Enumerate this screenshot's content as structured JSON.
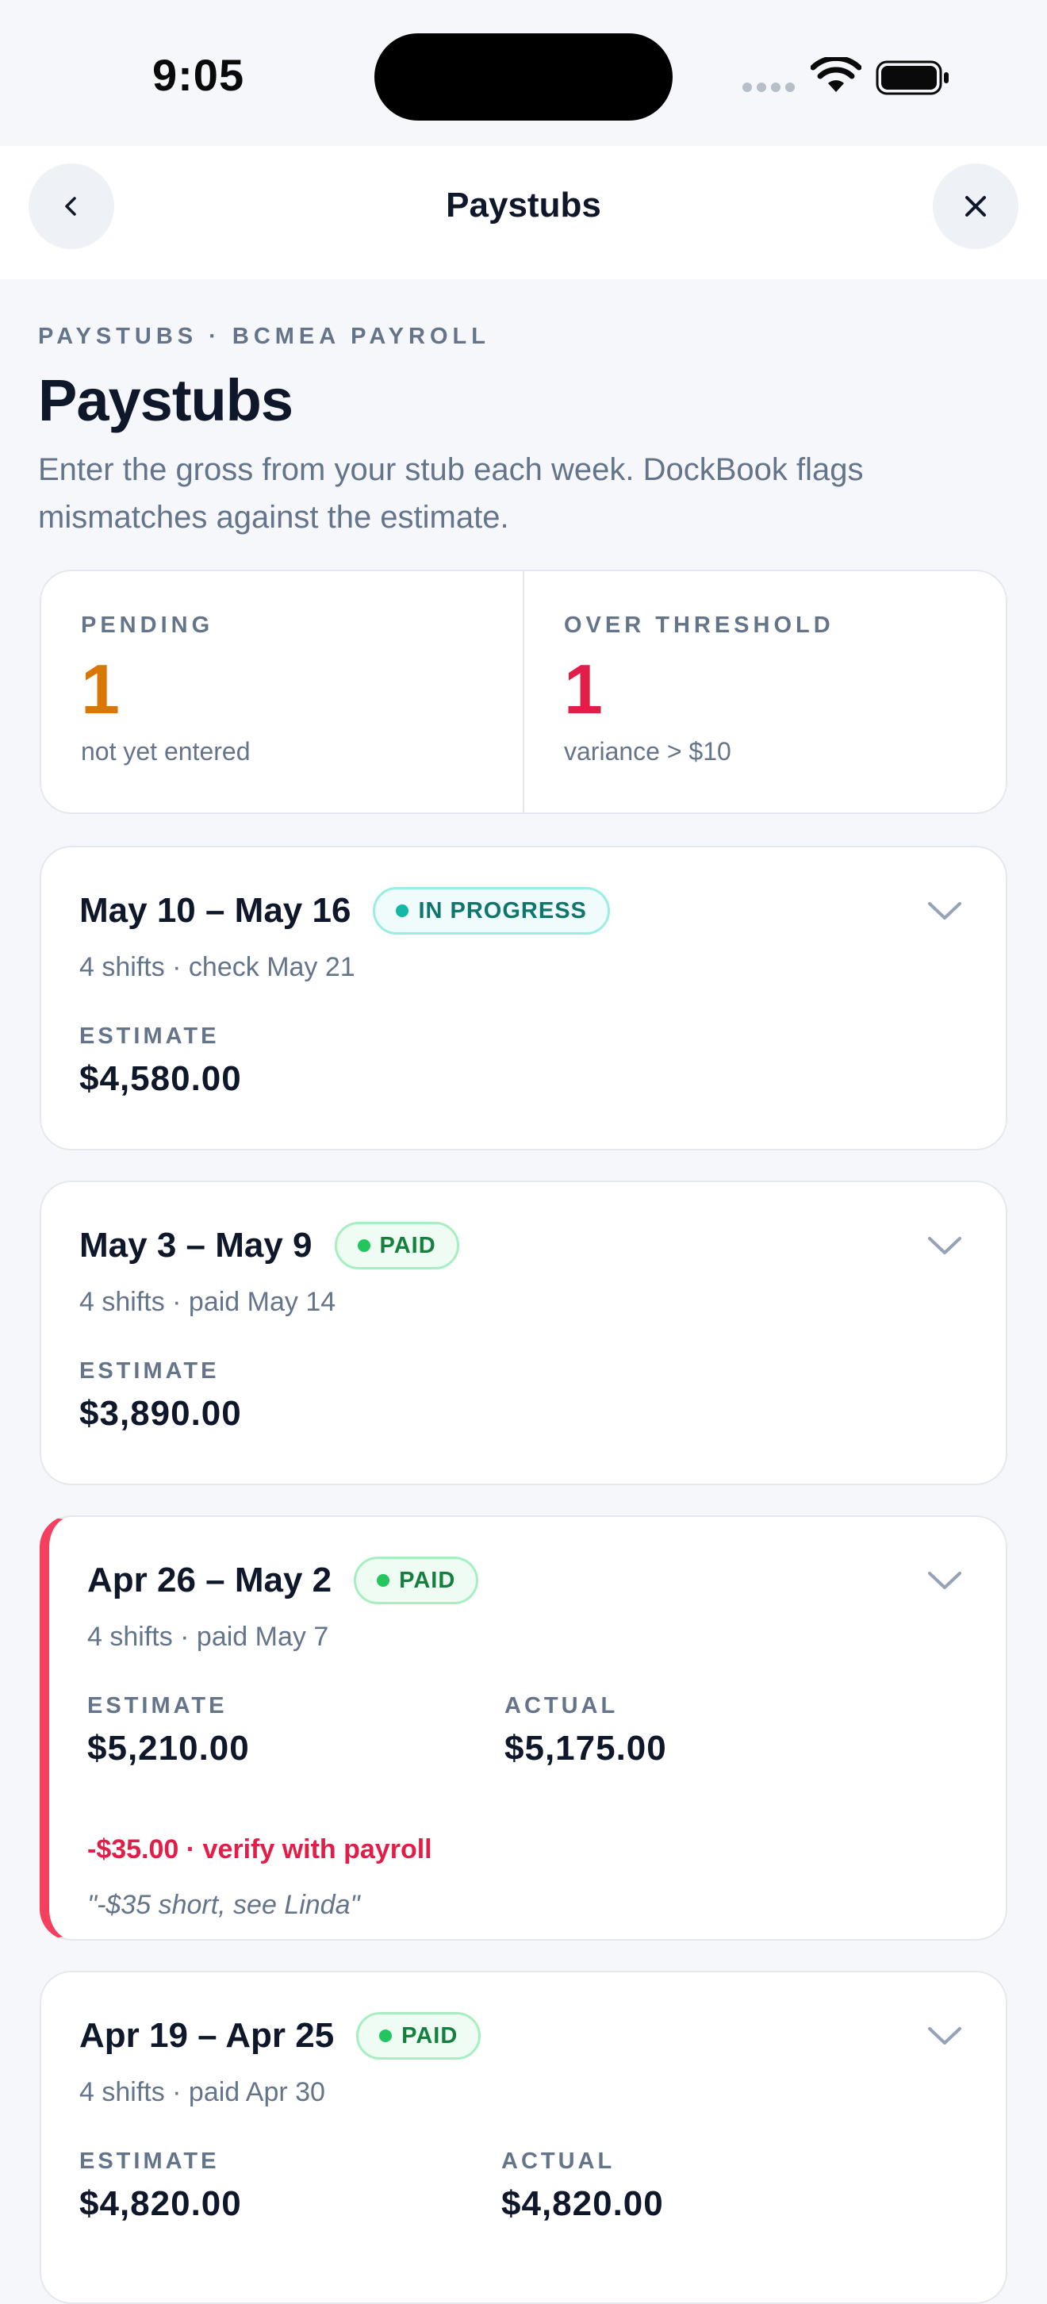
{
  "status_bar": {
    "time": "9:05"
  },
  "nav": {
    "title": "Paystubs"
  },
  "header": {
    "eyebrow": "PAYSTUBS · BCMEA PAYROLL",
    "title": "Paystubs",
    "subtitle": "Enter the gross from your stub each week. DockBook flags mismatches against the estimate."
  },
  "summary": {
    "pending": {
      "label": "PENDING",
      "count": "1",
      "note": "not yet entered",
      "color": "#d97706"
    },
    "over_threshold": {
      "label": "OVER THRESHOLD",
      "count": "1",
      "note": "variance > $10",
      "color": "#e11d48"
    }
  },
  "weeks": [
    {
      "range": "May 10 – May 16",
      "status": "IN PROGRESS",
      "meta": "4 shifts · check May 21",
      "estimate_label": "ESTIMATE",
      "estimate": "$4,580.00"
    },
    {
      "range": "May 3 – May 9",
      "status": "PAID",
      "meta": "4 shifts · paid May 14",
      "estimate_label": "ESTIMATE",
      "estimate": "$3,890.00"
    },
    {
      "range": "Apr 26 – May 2",
      "status": "PAID",
      "meta": "4 shifts · paid May 7",
      "estimate_label": "ESTIMATE",
      "estimate": "$5,210.00",
      "actual_label": "ACTUAL",
      "actual": "$5,175.00",
      "variance": "-$35.00  · verify with payroll",
      "note": "\"-$35 short, see Linda\"",
      "flag_color": "#f43f5e"
    },
    {
      "range": "Apr 19 – Apr 25",
      "status": "PAID",
      "meta": "4 shifts · paid Apr 30",
      "estimate_label": "ESTIMATE",
      "estimate": "$4,820.00",
      "actual_label": "ACTUAL",
      "actual": "$4,820.00"
    }
  ],
  "icons": {
    "back": "chevron-left-icon",
    "close": "close-icon",
    "expand": "chevron-down-icon"
  }
}
